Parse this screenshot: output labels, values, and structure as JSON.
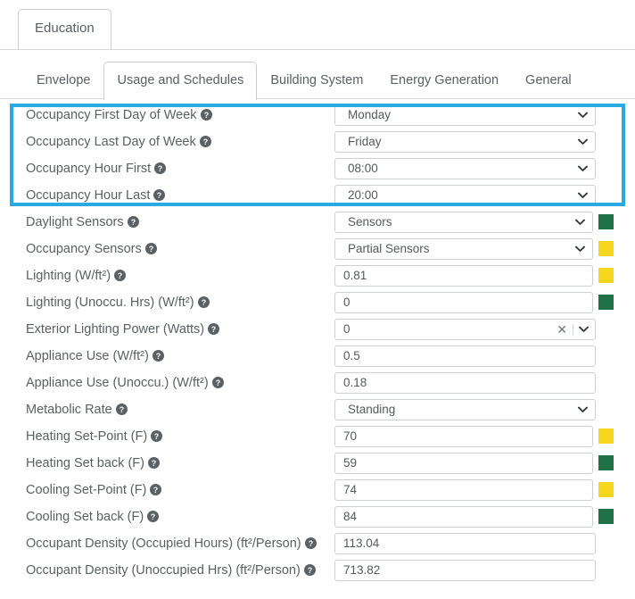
{
  "outer_tabs": [
    {
      "label": "Education",
      "active": true
    }
  ],
  "inner_tabs": [
    {
      "label": "Envelope",
      "active": false
    },
    {
      "label": "Usage and Schedules",
      "active": true
    },
    {
      "label": "Building System",
      "active": false
    },
    {
      "label": "Energy Generation",
      "active": false
    },
    {
      "label": "General",
      "active": false
    }
  ],
  "icons": {
    "help": "help-circle-icon",
    "chevron": "chevron-down-icon",
    "clear": "clear-x-icon"
  },
  "colors": {
    "highlight_border": "#29ABE2",
    "swatch_green": "#1E7245",
    "swatch_yellow": "#F7D620",
    "field_border": "#ccd0d3",
    "text": "#5b6064"
  },
  "highlight": {
    "rows": 4,
    "note": "Blue highlight rectangle surrounds the four Occupancy schedule rows"
  },
  "rows": [
    {
      "label": "Occupancy First Day of Week",
      "type": "select",
      "value": "Monday",
      "swatch": null,
      "highlighted": true
    },
    {
      "label": "Occupancy Last Day of Week",
      "type": "select",
      "value": "Friday",
      "swatch": null,
      "highlighted": true
    },
    {
      "label": "Occupancy Hour First",
      "type": "select",
      "value": "08:00",
      "swatch": null,
      "highlighted": true
    },
    {
      "label": "Occupancy Hour Last",
      "type": "select",
      "value": "20:00",
      "swatch": null,
      "highlighted": true
    },
    {
      "label": "Daylight Sensors",
      "type": "select",
      "value": "Sensors",
      "swatch": "green",
      "highlighted": false
    },
    {
      "label": "Occupancy Sensors",
      "type": "select",
      "value": "Partial Sensors",
      "swatch": "yellow",
      "highlighted": false
    },
    {
      "label": "Lighting (W/ft²)",
      "type": "text",
      "value": "0.81",
      "swatch": "yellow",
      "highlighted": false
    },
    {
      "label": "Lighting (Unoccu. Hrs) (W/ft²)",
      "type": "text",
      "value": "0",
      "swatch": "green",
      "highlighted": false
    },
    {
      "label": "Exterior Lighting Power (Watts)",
      "type": "combo",
      "value": "0",
      "swatch": null,
      "highlighted": false
    },
    {
      "label": "Appliance Use (W/ft²)",
      "type": "text",
      "value": "0.5",
      "swatch": null,
      "highlighted": false
    },
    {
      "label": "Appliance Use (Unoccu.) (W/ft²)",
      "type": "text",
      "value": "0.18",
      "swatch": null,
      "highlighted": false
    },
    {
      "label": "Metabolic Rate",
      "type": "select",
      "value": "Standing",
      "swatch": null,
      "highlighted": false
    },
    {
      "label": "Heating Set-Point (F)",
      "type": "text",
      "value": "70",
      "swatch": "yellow",
      "highlighted": false
    },
    {
      "label": "Heating Set back (F)",
      "type": "text",
      "value": "59",
      "swatch": "green",
      "highlighted": false
    },
    {
      "label": "Cooling Set-Point (F)",
      "type": "text",
      "value": "74",
      "swatch": "yellow",
      "highlighted": false
    },
    {
      "label": "Cooling Set back (F)",
      "type": "text",
      "value": "84",
      "swatch": "green",
      "highlighted": false
    },
    {
      "label": "Occupant Density (Occupied Hours) (ft²/Person)",
      "type": "text",
      "value": "113.04",
      "swatch": null,
      "highlighted": false
    },
    {
      "label": "Occupant Density (Unoccupied Hrs) (ft²/Person)",
      "type": "text",
      "value": "713.82",
      "swatch": null,
      "highlighted": false
    }
  ]
}
